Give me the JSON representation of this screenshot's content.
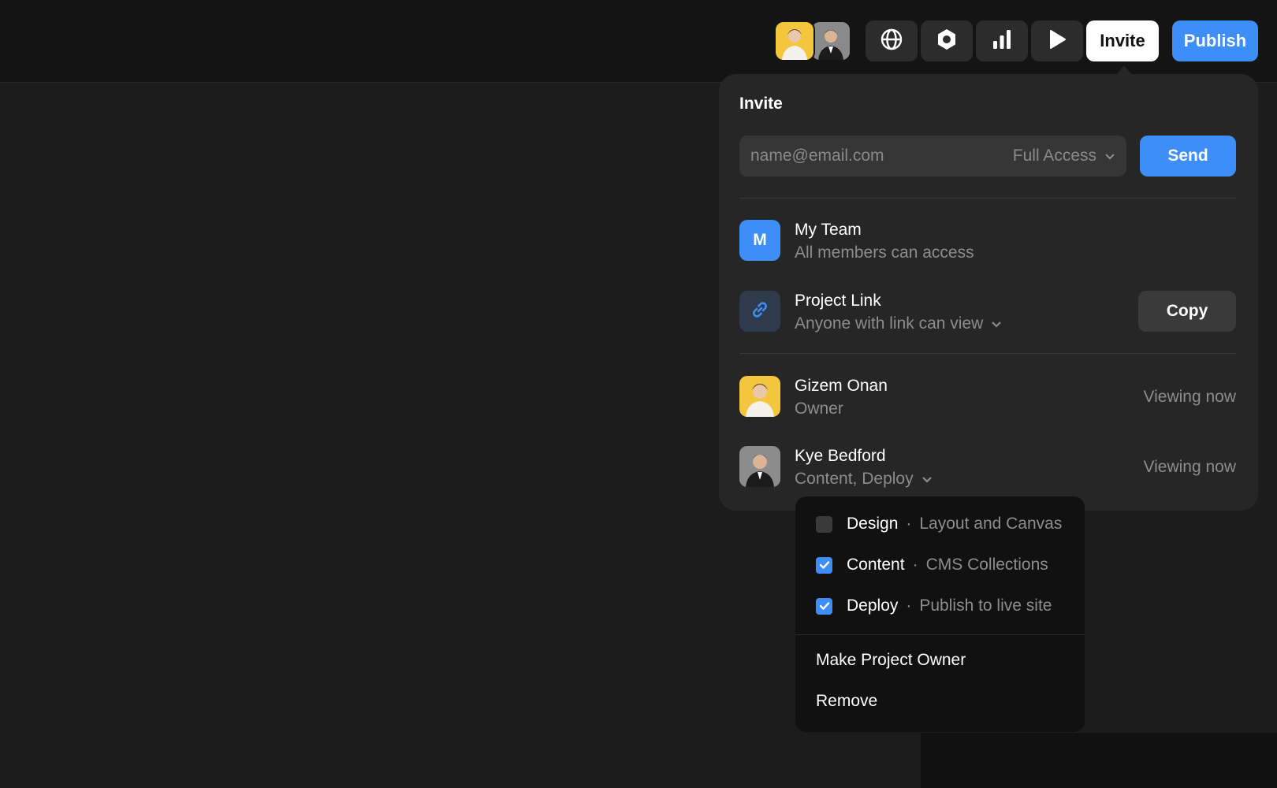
{
  "header": {
    "collaborators": [
      {
        "name": "Gizem Onan",
        "color": "#f4c63d"
      },
      {
        "name": "Kye Bedford",
        "color": "#6e6e6e"
      }
    ],
    "icons": [
      "globe-icon",
      "settings-icon",
      "analytics-icon",
      "play-icon"
    ],
    "invite_label": "Invite",
    "publish_label": "Publish"
  },
  "invite_panel": {
    "title": "Invite",
    "email_placeholder": "name@email.com",
    "access_level": "Full Access",
    "send_label": "Send",
    "team": {
      "initial": "M",
      "name": "My Team",
      "description": "All members can access"
    },
    "project_link": {
      "name": "Project Link",
      "permission": "Anyone with link can view",
      "copy_label": "Copy"
    },
    "members": [
      {
        "name": "Gizem Onan",
        "role": "Owner",
        "status": "Viewing now"
      },
      {
        "name": "Kye Bedford",
        "role": "Content, Deploy",
        "status": "Viewing now"
      }
    ]
  },
  "permissions_menu": {
    "items": [
      {
        "label": "Design",
        "separator": "·",
        "description": "Layout and Canvas",
        "checked": false
      },
      {
        "label": "Content",
        "separator": "·",
        "description": "CMS Collections",
        "checked": true
      },
      {
        "label": "Deploy",
        "separator": "·",
        "description": "Publish to live site",
        "checked": true
      }
    ],
    "make_owner_label": "Make Project Owner",
    "remove_label": "Remove"
  },
  "colors": {
    "accent": "#3d8ef7",
    "background": "#1c1c1c",
    "panel": "#262626",
    "menu": "#111111"
  }
}
